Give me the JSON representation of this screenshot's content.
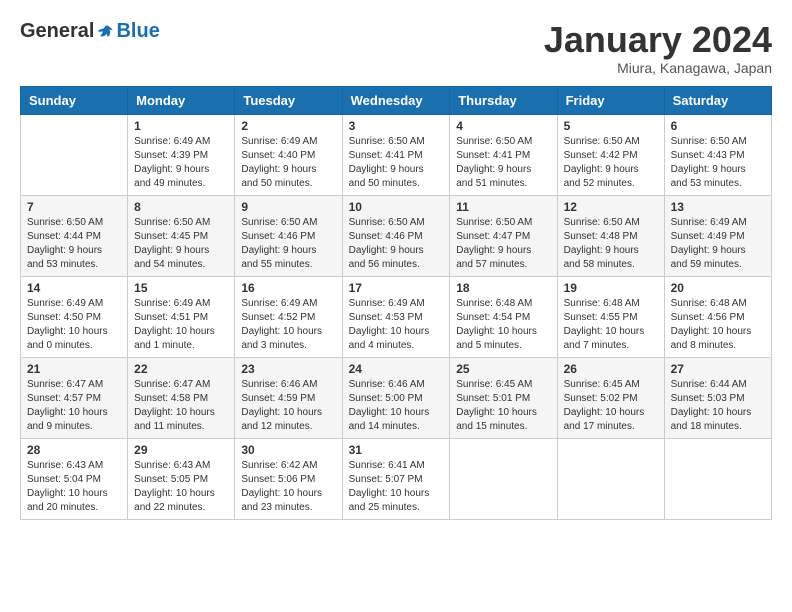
{
  "header": {
    "logo_general": "General",
    "logo_blue": "Blue",
    "month_title": "January 2024",
    "subtitle": "Miura, Kanagawa, Japan"
  },
  "weekdays": [
    "Sunday",
    "Monday",
    "Tuesday",
    "Wednesday",
    "Thursday",
    "Friday",
    "Saturday"
  ],
  "weeks": [
    [
      {
        "day": "",
        "info": ""
      },
      {
        "day": "1",
        "info": "Sunrise: 6:49 AM\nSunset: 4:39 PM\nDaylight: 9 hours\nand 49 minutes."
      },
      {
        "day": "2",
        "info": "Sunrise: 6:49 AM\nSunset: 4:40 PM\nDaylight: 9 hours\nand 50 minutes."
      },
      {
        "day": "3",
        "info": "Sunrise: 6:50 AM\nSunset: 4:41 PM\nDaylight: 9 hours\nand 50 minutes."
      },
      {
        "day": "4",
        "info": "Sunrise: 6:50 AM\nSunset: 4:41 PM\nDaylight: 9 hours\nand 51 minutes."
      },
      {
        "day": "5",
        "info": "Sunrise: 6:50 AM\nSunset: 4:42 PM\nDaylight: 9 hours\nand 52 minutes."
      },
      {
        "day": "6",
        "info": "Sunrise: 6:50 AM\nSunset: 4:43 PM\nDaylight: 9 hours\nand 53 minutes."
      }
    ],
    [
      {
        "day": "7",
        "info": "Sunrise: 6:50 AM\nSunset: 4:44 PM\nDaylight: 9 hours\nand 53 minutes."
      },
      {
        "day": "8",
        "info": "Sunrise: 6:50 AM\nSunset: 4:45 PM\nDaylight: 9 hours\nand 54 minutes."
      },
      {
        "day": "9",
        "info": "Sunrise: 6:50 AM\nSunset: 4:46 PM\nDaylight: 9 hours\nand 55 minutes."
      },
      {
        "day": "10",
        "info": "Sunrise: 6:50 AM\nSunset: 4:46 PM\nDaylight: 9 hours\nand 56 minutes."
      },
      {
        "day": "11",
        "info": "Sunrise: 6:50 AM\nSunset: 4:47 PM\nDaylight: 9 hours\nand 57 minutes."
      },
      {
        "day": "12",
        "info": "Sunrise: 6:50 AM\nSunset: 4:48 PM\nDaylight: 9 hours\nand 58 minutes."
      },
      {
        "day": "13",
        "info": "Sunrise: 6:49 AM\nSunset: 4:49 PM\nDaylight: 9 hours\nand 59 minutes."
      }
    ],
    [
      {
        "day": "14",
        "info": "Sunrise: 6:49 AM\nSunset: 4:50 PM\nDaylight: 10 hours\nand 0 minutes."
      },
      {
        "day": "15",
        "info": "Sunrise: 6:49 AM\nSunset: 4:51 PM\nDaylight: 10 hours\nand 1 minute."
      },
      {
        "day": "16",
        "info": "Sunrise: 6:49 AM\nSunset: 4:52 PM\nDaylight: 10 hours\nand 3 minutes."
      },
      {
        "day": "17",
        "info": "Sunrise: 6:49 AM\nSunset: 4:53 PM\nDaylight: 10 hours\nand 4 minutes."
      },
      {
        "day": "18",
        "info": "Sunrise: 6:48 AM\nSunset: 4:54 PM\nDaylight: 10 hours\nand 5 minutes."
      },
      {
        "day": "19",
        "info": "Sunrise: 6:48 AM\nSunset: 4:55 PM\nDaylight: 10 hours\nand 7 minutes."
      },
      {
        "day": "20",
        "info": "Sunrise: 6:48 AM\nSunset: 4:56 PM\nDaylight: 10 hours\nand 8 minutes."
      }
    ],
    [
      {
        "day": "21",
        "info": "Sunrise: 6:47 AM\nSunset: 4:57 PM\nDaylight: 10 hours\nand 9 minutes."
      },
      {
        "day": "22",
        "info": "Sunrise: 6:47 AM\nSunset: 4:58 PM\nDaylight: 10 hours\nand 11 minutes."
      },
      {
        "day": "23",
        "info": "Sunrise: 6:46 AM\nSunset: 4:59 PM\nDaylight: 10 hours\nand 12 minutes."
      },
      {
        "day": "24",
        "info": "Sunrise: 6:46 AM\nSunset: 5:00 PM\nDaylight: 10 hours\nand 14 minutes."
      },
      {
        "day": "25",
        "info": "Sunrise: 6:45 AM\nSunset: 5:01 PM\nDaylight: 10 hours\nand 15 minutes."
      },
      {
        "day": "26",
        "info": "Sunrise: 6:45 AM\nSunset: 5:02 PM\nDaylight: 10 hours\nand 17 minutes."
      },
      {
        "day": "27",
        "info": "Sunrise: 6:44 AM\nSunset: 5:03 PM\nDaylight: 10 hours\nand 18 minutes."
      }
    ],
    [
      {
        "day": "28",
        "info": "Sunrise: 6:43 AM\nSunset: 5:04 PM\nDaylight: 10 hours\nand 20 minutes."
      },
      {
        "day": "29",
        "info": "Sunrise: 6:43 AM\nSunset: 5:05 PM\nDaylight: 10 hours\nand 22 minutes."
      },
      {
        "day": "30",
        "info": "Sunrise: 6:42 AM\nSunset: 5:06 PM\nDaylight: 10 hours\nand 23 minutes."
      },
      {
        "day": "31",
        "info": "Sunrise: 6:41 AM\nSunset: 5:07 PM\nDaylight: 10 hours\nand 25 minutes."
      },
      {
        "day": "",
        "info": ""
      },
      {
        "day": "",
        "info": ""
      },
      {
        "day": "",
        "info": ""
      }
    ]
  ]
}
